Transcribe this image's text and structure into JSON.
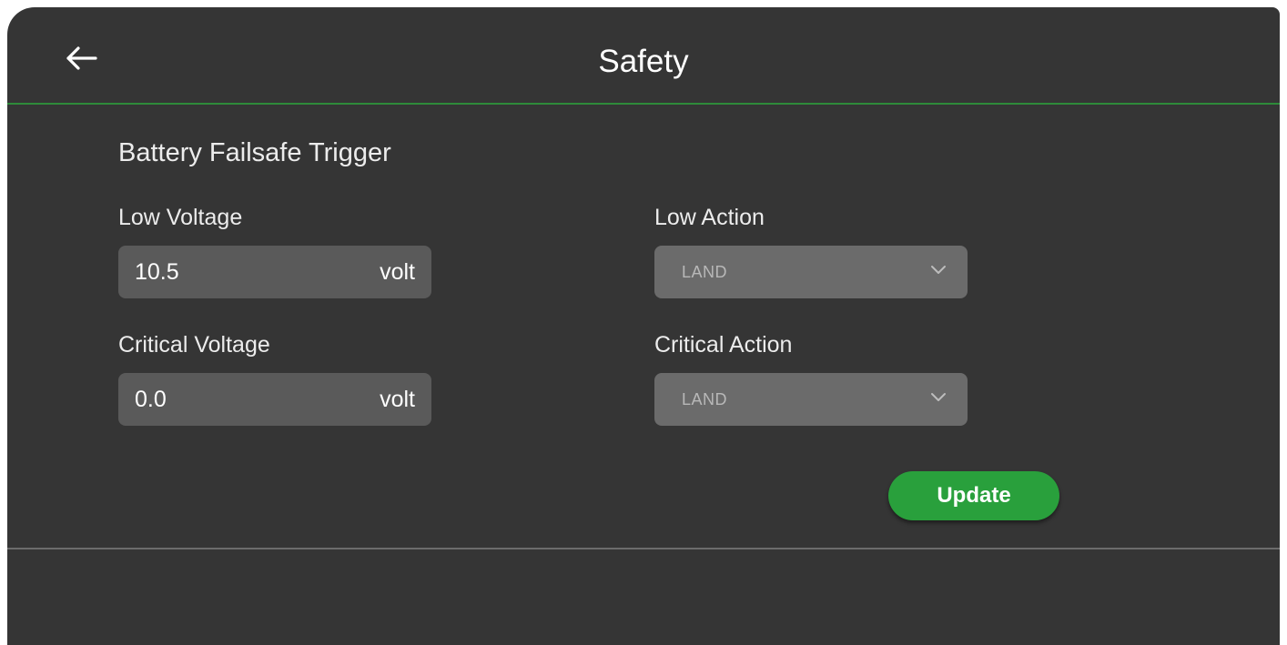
{
  "header": {
    "title": "Safety",
    "back_icon": "arrow-left-icon"
  },
  "battery": {
    "section_title": "Battery Failsafe Trigger",
    "low_voltage": {
      "label": "Low Voltage",
      "value": "10.5",
      "unit": "volt"
    },
    "critical_voltage": {
      "label": "Critical Voltage",
      "value": "0.0",
      "unit": "volt"
    },
    "low_action": {
      "label": "Low Action",
      "value": "LAND",
      "icon": "chevron-down-icon"
    },
    "critical_action": {
      "label": "Critical Action",
      "value": "LAND",
      "icon": "chevron-down-icon"
    }
  },
  "actions": {
    "update_label": "Update"
  },
  "colors": {
    "background": "#353535",
    "accent": "#29a03c",
    "header_border": "#2e8b3a",
    "field": "#5a5a5a",
    "select": "#6b6b6b"
  }
}
